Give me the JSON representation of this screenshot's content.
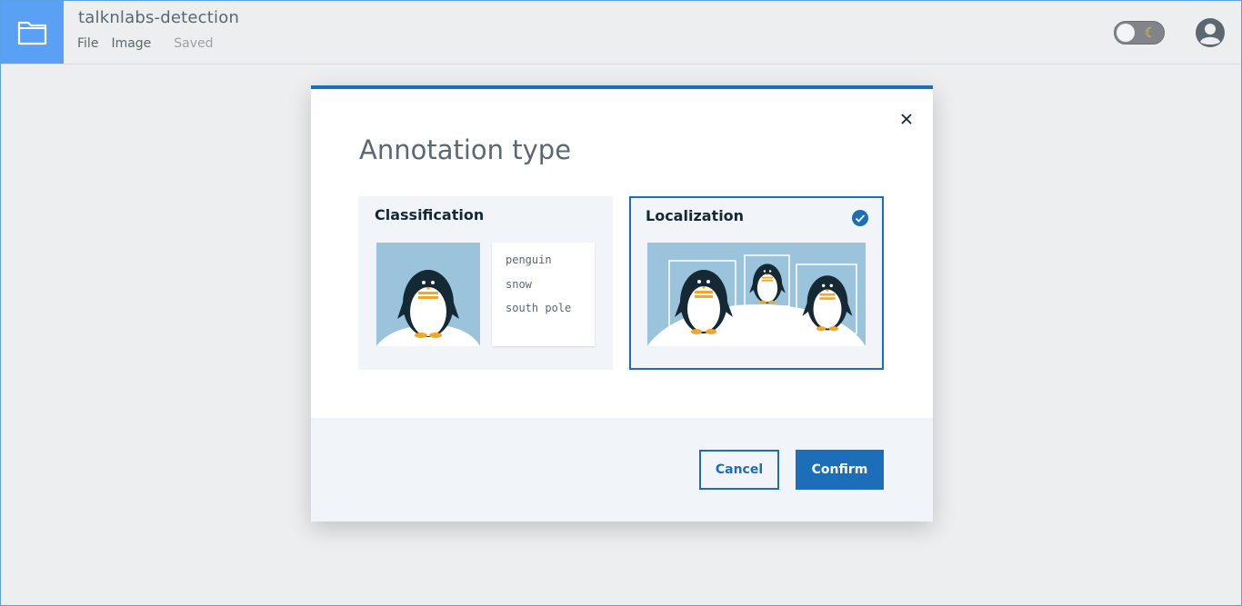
{
  "header": {
    "project_title": "talknlabs-detection",
    "menu": [
      "File",
      "Image"
    ],
    "status": "Saved",
    "theme_toggle_icon": "moon-icon",
    "folder_icon": "folder-icon",
    "avatar_icon": "user-avatar-icon"
  },
  "modal": {
    "title": "Annotation type",
    "close_icon": "close-icon",
    "options": [
      {
        "label": "Classification",
        "selected": false,
        "tags": [
          "penguin",
          "snow",
          "south pole"
        ]
      },
      {
        "label": "Localization",
        "selected": true
      }
    ],
    "cancel_label": "Cancel",
    "confirm_label": "Confirm"
  },
  "colors": {
    "accent": "#1c6eb8",
    "folder_bg": "#5aa0f5",
    "sky": "#9bc4dc"
  }
}
